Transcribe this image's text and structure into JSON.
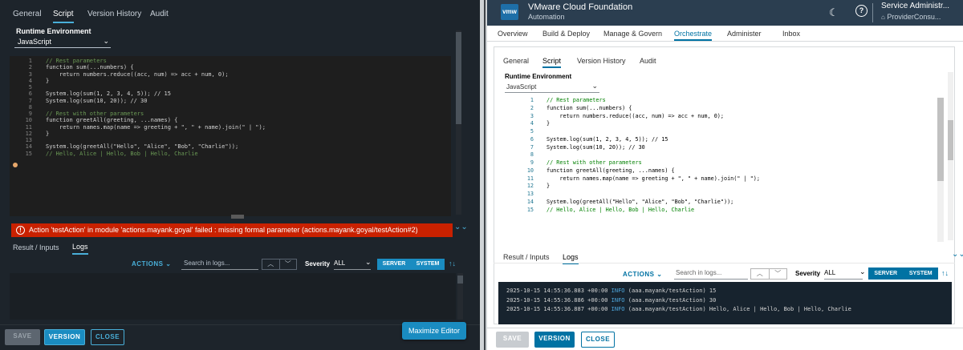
{
  "left": {
    "tabs": [
      "General",
      "Script",
      "Version History",
      "Audit"
    ],
    "runtime_label": "Runtime Environment",
    "runtime_value": "JavaScript",
    "error": "Action 'testAction' in module 'actions.mayank.goyal' failed : missing formal parameter (actions.mayank.goyal/testAction#2)",
    "bottom_tabs": [
      "Result / Inputs",
      "Logs"
    ],
    "actions_label": "ACTIONS",
    "search_placeholder": "Search in logs...",
    "severity_label": "Severity",
    "severity_value": "ALL",
    "seg": [
      "SERVER",
      "SYSTEM"
    ],
    "footer": {
      "save": "SAVE",
      "version": "VERSION",
      "close": "CLOSE"
    },
    "maximize": "Maximize Editor"
  },
  "code": [
    {
      "n": "1",
      "t": "// Rest parameters",
      "c": true
    },
    {
      "n": "2",
      "t": "function sum(...numbers) {",
      "c": false
    },
    {
      "n": "3",
      "t": "    return numbers.reduce((acc, num) => acc + num, 0);",
      "c": false
    },
    {
      "n": "4",
      "t": "}",
      "c": false
    },
    {
      "n": "5",
      "t": "",
      "c": false
    },
    {
      "n": "6",
      "t": "System.log(sum(1, 2, 3, 4, 5)); // 15",
      "c": false
    },
    {
      "n": "7",
      "t": "System.log(sum(10, 20)); // 30",
      "c": false
    },
    {
      "n": "8",
      "t": "",
      "c": false
    },
    {
      "n": "9",
      "t": "// Rest with other parameters",
      "c": true
    },
    {
      "n": "10",
      "t": "function greetAll(greeting, ...names) {",
      "c": false
    },
    {
      "n": "11",
      "t": "    return names.map(name => greeting + \", \" + name).join(\" | \");",
      "c": false
    },
    {
      "n": "12",
      "t": "}",
      "c": false
    },
    {
      "n": "13",
      "t": "",
      "c": false
    },
    {
      "n": "14",
      "t": "System.log(greetAll(\"Hello\", \"Alice\", \"Bob\", \"Charlie\"));",
      "c": false
    },
    {
      "n": "15",
      "t": "// Hello, Alice | Hello, Bob | Hello, Charlie",
      "c": true
    }
  ],
  "right": {
    "header": {
      "logo": "vmw",
      "title": "VMware Cloud Foundation",
      "subtitle": "Automation",
      "user": "Service Administr...",
      "org": "ProviderConsu..."
    },
    "nav": [
      "Overview",
      "Build & Deploy",
      "Manage & Govern",
      "Orchestrate",
      "Administer",
      "Inbox"
    ],
    "tabs": [
      "General",
      "Script",
      "Version History",
      "Audit"
    ],
    "runtime_label": "Runtime Environment",
    "runtime_value": "JavaScript",
    "bottom_tabs": [
      "Result / Inputs",
      "Logs"
    ],
    "actions_label": "ACTIONS",
    "search_placeholder": "Search in logs...",
    "severity_label": "Severity",
    "severity_value": "ALL",
    "seg": [
      "SERVER",
      "SYSTEM"
    ],
    "logs": [
      {
        "ts": "2025-10-15 14:55:36.883 +00:00",
        "lvl": "INFO",
        "msg": "(aaa.mayank/testAction) 15"
      },
      {
        "ts": "2025-10-15 14:55:36.886 +00:00",
        "lvl": "INFO",
        "msg": "(aaa.mayank/testAction) 30"
      },
      {
        "ts": "2025-10-15 14:55:36.887 +00:00",
        "lvl": "INFO",
        "msg": "(aaa.mayank/testAction) Hello, Alice | Hello, Bob | Hello, Charlie"
      }
    ],
    "footer": {
      "save": "SAVE",
      "version": "VERSION",
      "close": "CLOSE"
    }
  },
  "colors": {
    "accent": "#0072a3",
    "error": "#c92100",
    "dark_bg": "#1d242b",
    "header": "#2b3e50"
  }
}
